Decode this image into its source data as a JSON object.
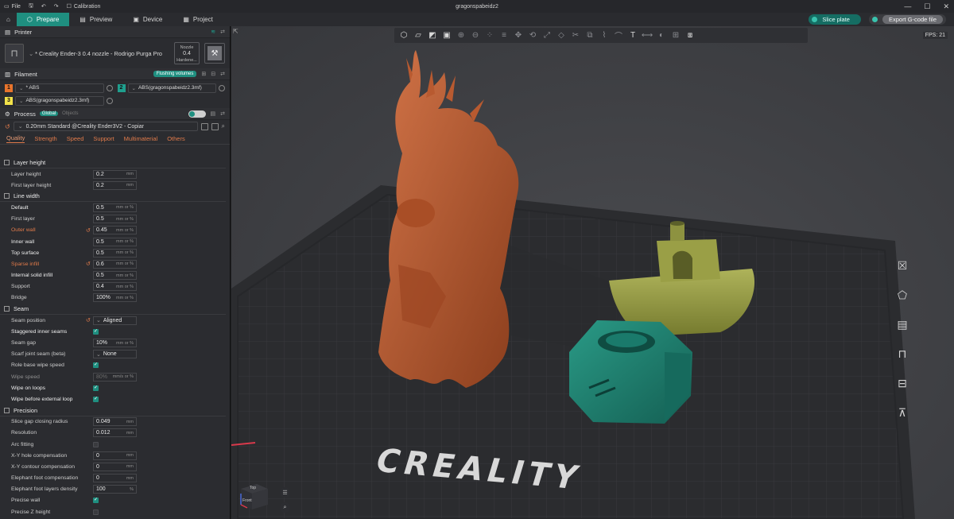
{
  "titlebar": {
    "file_label": "File",
    "calibration_label": "Calibration",
    "doc_title": "gragonspabeidz2"
  },
  "tabs": [
    {
      "label": "Prepare"
    },
    {
      "label": "Preview"
    },
    {
      "label": "Device"
    },
    {
      "label": "Project"
    }
  ],
  "actions": {
    "slice_label": "Slice plate",
    "export_label": "Export G-code file"
  },
  "printer": {
    "section_title": "Printer",
    "name": "* Creality Ender-3  0.4 nozzle - Rodrigo Purga Pro",
    "nozzle_label": "Nozzle",
    "nozzle_value": "0.4",
    "hardened_label": "Hardene..."
  },
  "filament": {
    "section_title": "Filament",
    "flushing_label": "Flushing volumes",
    "items": [
      {
        "num": "1",
        "color": "#e8742c",
        "name": "* ABS"
      },
      {
        "num": "2",
        "color": "#1f9f8e",
        "name": "ABS(gragonspabeidz2.3mf)"
      },
      {
        "num": "3",
        "color": "#f2e24a",
        "name": "ABS(gragonspabeidz2.3mf)"
      }
    ]
  },
  "process": {
    "section_title": "Process",
    "global_label": "Global",
    "objects_label": "Objects",
    "preset": "0.20mm Standard @Creality Ender3V2 - Copiar"
  },
  "subtabs": [
    "Quality",
    "Strength",
    "Speed",
    "Support",
    "Multimaterial",
    "Others"
  ],
  "groups": {
    "layer_height": {
      "title": "Layer height",
      "rows": [
        {
          "label": "Layer height",
          "value": "0.2",
          "unit": "mm"
        },
        {
          "label": "First layer height",
          "value": "0.2",
          "unit": "mm"
        }
      ]
    },
    "line_width": {
      "title": "Line width",
      "rows": [
        {
          "label": "Default",
          "value": "0.5",
          "unit": "mm or %"
        },
        {
          "label": "First layer",
          "value": "0.5",
          "unit": "mm or %"
        },
        {
          "label": "Outer wall",
          "value": "0.45",
          "unit": "mm or %"
        },
        {
          "label": "Inner wall",
          "value": "0.5",
          "unit": "mm or %"
        },
        {
          "label": "Top surface",
          "value": "0.5",
          "unit": "mm or %"
        },
        {
          "label": "Sparse infill",
          "value": "0.6",
          "unit": "mm or %"
        },
        {
          "label": "Internal solid infill",
          "value": "0.5",
          "unit": "mm or %"
        },
        {
          "label": "Support",
          "value": "0.4",
          "unit": "mm or %"
        },
        {
          "label": "Bridge",
          "value": "100%",
          "unit": "mm or %"
        }
      ]
    },
    "seam": {
      "title": "Seam",
      "seam_position": {
        "label": "Seam position",
        "value": "Aligned"
      },
      "staggered": {
        "label": "Staggered inner seams"
      },
      "seam_gap": {
        "label": "Seam gap",
        "value": "10%",
        "unit": "mm or %"
      },
      "scarf": {
        "label": "Scarf joint seam (beta)",
        "value": "None"
      },
      "role_wipe": {
        "label": "Role base wipe speed"
      },
      "wipe_speed": {
        "label": "Wipe speed",
        "value": "80%",
        "unit": "mm/s or %"
      },
      "wipe_loops": {
        "label": "Wipe on loops"
      },
      "wipe_before": {
        "label": "Wipe before external loop"
      }
    },
    "precision": {
      "title": "Precision",
      "slice_gap": {
        "label": "Slice gap closing radius",
        "value": "0.049",
        "unit": "mm"
      },
      "resolution": {
        "label": "Resolution",
        "value": "0.012",
        "unit": "mm"
      },
      "arc_fitting": {
        "label": "Arc fitting"
      },
      "xy_hole": {
        "label": "X-Y hole compensation",
        "value": "0",
        "unit": "mm"
      },
      "xy_contour": {
        "label": "X-Y contour compensation",
        "value": "0",
        "unit": "mm"
      },
      "elephant": {
        "label": "Elephant foot compensation",
        "value": "0",
        "unit": "mm"
      },
      "elephant_layers": {
        "label": "Elephant foot layers density",
        "value": "100",
        "unit": "%"
      },
      "precise_wall": {
        "label": "Precise wall"
      },
      "precise_z": {
        "label": "Precise Z height"
      }
    }
  },
  "viewport": {
    "fps": "FPS: 21",
    "brand": "CREALITY"
  },
  "cube_nav": {
    "top": "Top",
    "front": "Front"
  }
}
